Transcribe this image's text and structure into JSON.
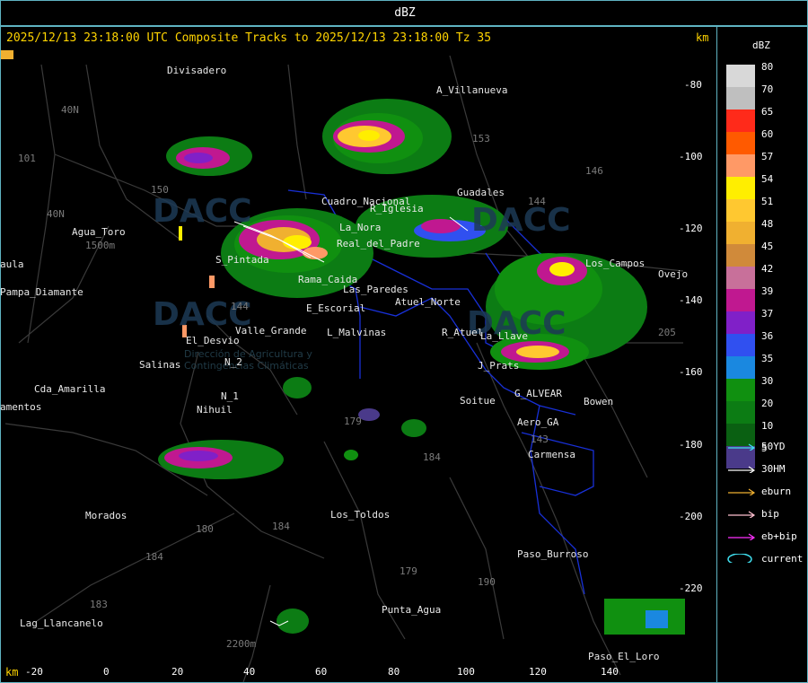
{
  "title": "dBZ",
  "header": "2025/12/13 23:18:00 UTC Composite Tracks to 2025/12/13 23:18:00 Tz 35",
  "km_label": "km",
  "y_ticks": [
    "-80",
    "-100",
    "-120",
    "-140",
    "-160",
    "-180",
    "-200",
    "-220"
  ],
  "x_ticks": [
    "-20",
    "0",
    "20",
    "40",
    "60",
    "80",
    "100",
    "120",
    "140"
  ],
  "places": [
    "Divisadero",
    "A_Villanueva",
    "Agua_Toro",
    "Pampa_Diamante",
    "aula",
    "Cda_Amarilla",
    "amentos",
    "Salinas",
    "N_2",
    "N_1",
    "Nihuil",
    "El_Desvio",
    "Valle_Grande",
    "E_Escorial",
    "L_Malvinas",
    "Atuel_Norte",
    "R_Atuel",
    "Soitue",
    "G_ALVEAR",
    "Bowen",
    "Aero_GA",
    "Carmensa",
    "Guadales",
    "Los_Campos",
    "Ovejo",
    "J_Prats",
    "La_Llave",
    "Los_Toldos",
    "Morados",
    "Paso_Burroso",
    "Punta_Agua",
    "Lag_Llancanelo",
    "Paso_El_Loro",
    "S_Pintada",
    "Rama_Caida",
    "La_Nora",
    "Real_del_Padre",
    "Cuadro_Nacional",
    "R_Iglesia",
    "Las_Paredes"
  ],
  "roads": [
    "40N",
    "101",
    "40N",
    "150",
    "153",
    "146",
    "144",
    "144",
    "179",
    "184",
    "180",
    "184",
    "179",
    "190",
    "183",
    "184",
    "2200m",
    "1500m",
    "143",
    "205"
  ],
  "watermarks": [
    "DACC",
    "DACC",
    "DACC",
    "DACC"
  ],
  "watermark_sub": "Dirección de Agricultura y Contingencias Climáticas",
  "legend": {
    "title": "dBZ",
    "levels": [
      {
        "label": "80",
        "color": "#d8d8d8"
      },
      {
        "label": "70",
        "color": "#bfbfbf"
      },
      {
        "label": "65",
        "color": "#ff2a1a"
      },
      {
        "label": "60",
        "color": "#ff5a00"
      },
      {
        "label": "57",
        "color": "#ff9966"
      },
      {
        "label": "54",
        "color": "#ffee00"
      },
      {
        "label": "51",
        "color": "#ffc830"
      },
      {
        "label": "48",
        "color": "#f0b030"
      },
      {
        "label": "45",
        "color": "#d08a3a"
      },
      {
        "label": "42",
        "color": "#c8709a"
      },
      {
        "label": "39",
        "color": "#c01890"
      },
      {
        "label": "37",
        "color": "#8020c8"
      },
      {
        "label": "36",
        "color": "#3050f0"
      },
      {
        "label": "35",
        "color": "#1a88e0"
      },
      {
        "label": "30",
        "color": "#109010"
      },
      {
        "label": "20",
        "color": "#0c7c14"
      },
      {
        "label": "10",
        "color": "#0a6012"
      },
      {
        "label": "5",
        "color": "#4a3a8a"
      }
    ],
    "tracks": [
      {
        "label": "50YD",
        "color": "#40e0f0"
      },
      {
        "label": "30HM",
        "color": "#ffffff"
      },
      {
        "label": "eburn",
        "color": "#f0b030"
      },
      {
        "label": "bip",
        "color": "#ffc0d0"
      },
      {
        "label": "eb+bip",
        "color": "#ff30ff"
      },
      {
        "label": "current",
        "color": "#40e0f0"
      }
    ]
  }
}
